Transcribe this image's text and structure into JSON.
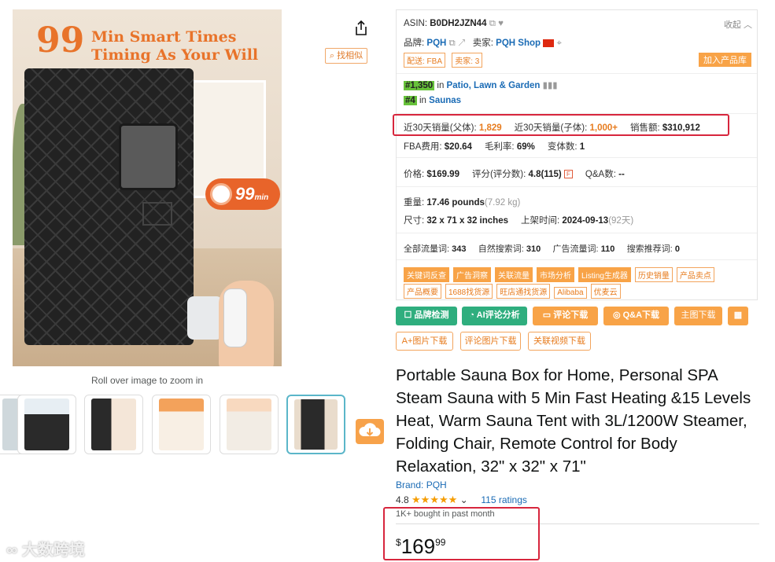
{
  "image": {
    "headline_number": "99",
    "headline_line1": "Min Smart Times",
    "headline_line2": "Timing As Your Will",
    "badge_text": "99",
    "badge_unit": "min",
    "zoom_hint": "Roll over image to zoom in",
    "find_similar": "找相似"
  },
  "panel": {
    "asin_label": "ASIN:",
    "asin_value": "B0DH2JZN44",
    "collapse": "收起",
    "brand_label": "品牌:",
    "brand_value": "PQH",
    "seller_label": "卖家:",
    "seller_value": "PQH Shop",
    "tag_fba": "配送: FBA",
    "tag_sellers": "卖家: 3",
    "add_lib": "加入产品库",
    "rank1_num": "#1,350",
    "rank1_in": "in",
    "rank1_cat": "Patio, Lawn & Garden",
    "rank2_num": "#4",
    "rank2_in": "in",
    "rank2_cat": "Saunas",
    "sales_parent_label": "近30天销量(父体):",
    "sales_parent_value": "1,829",
    "sales_child_label": "近30天销量(子体):",
    "sales_child_value": "1,000+",
    "revenue_label": "销售额:",
    "revenue_value": "$310,912",
    "fba_fee_label": "FBA费用:",
    "fba_fee_value": "$20.64",
    "margin_label": "毛利率:",
    "margin_value": "69%",
    "variants_label": "变体数:",
    "variants_value": "1",
    "price_label": "价格:",
    "price_value": "$169.99",
    "rating_label": "评分(评分数):",
    "rating_value": "4.8(115)",
    "qa_label": "Q&A数:",
    "qa_value": "--",
    "weight_label": "重量:",
    "weight_value": "17.46 pounds",
    "weight_kg": "(7.92 kg)",
    "size_label": "尺寸:",
    "size_value": "32 x 71 x 32 inches",
    "listed_label": "上架时间:",
    "listed_value": "2024-09-13",
    "listed_days": "(92天)",
    "traffic_all_label": "全部流量词:",
    "traffic_all_value": "343",
    "traffic_organic_label": "自然搜索词:",
    "traffic_organic_value": "310",
    "traffic_ad_label": "广告流量词:",
    "traffic_ad_value": "110",
    "traffic_rec_label": "搜索推荐词:",
    "traffic_rec_value": "0",
    "tags_row1": [
      "关键词反查",
      "广告洞察",
      "关联流量",
      "市场分析",
      "Listing生成器",
      "历史销量",
      "产品卖点"
    ],
    "tags_row2": [
      "产品概要",
      "1688找货源",
      "旺店通找货源",
      "Alibaba",
      "优麦云"
    ]
  },
  "buttons": {
    "brand_check": "品牌检测",
    "ai_review": "AI评论分析",
    "review_download": "评论下载",
    "qa_download": "Q&A下载",
    "main_img_download": "主图下载",
    "aplus_download": "A+图片下载",
    "review_img_download": "评论图片下载",
    "related_video_download": "关联视频下载"
  },
  "product": {
    "title": "Portable Sauna Box for Home, Personal SPA Steam Sauna with 5 Min Fast Heating &15 Levels Heat, Warm Sauna Tent with 3L/1200W Steamer, Folding Chair, Remote Control for Body Relaxation, 32\" x 32\" x 71\"",
    "brand": "Brand: PQH",
    "rating": "4.8",
    "stars": "★★★★★",
    "ratings_count": "115 ratings",
    "bought": "1K+ bought in past month",
    "price_symbol": "$",
    "price_whole": "169",
    "price_fraction": "99"
  },
  "watermark": "大数跨境",
  "colors": {
    "highlight_red": "#d7263d",
    "orange": "#e77c1f",
    "green": "#2fae7e",
    "link": "#1a6bb5"
  }
}
